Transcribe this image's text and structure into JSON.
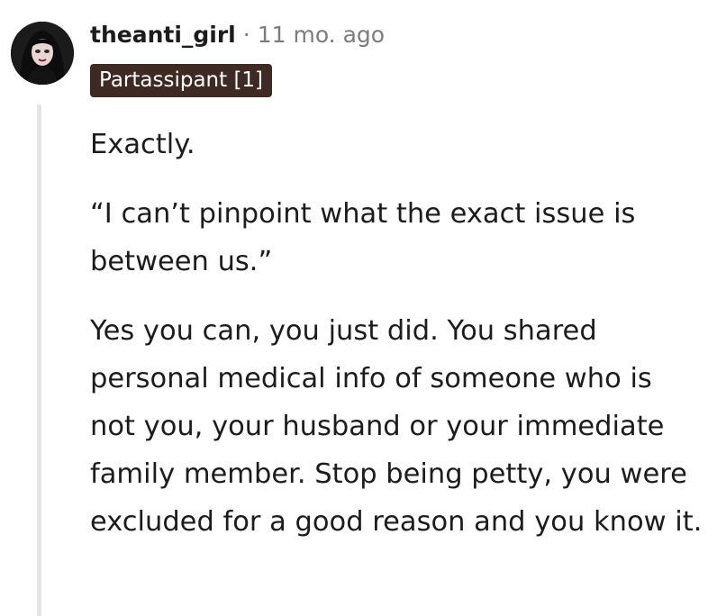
{
  "comment": {
    "author": "theanti_girl",
    "separator": "·",
    "timestamp": "11 mo. ago",
    "flair": "Partassipant [1]",
    "paragraphs": [
      "Exactly.",
      "“I can’t pinpoint what the exact issue is between us.”",
      "Yes you can, you just did. You shared personal medical info of someone who is not you, your husband or your immediate family member. Stop being petty, you were excluded for a good reason and you know it."
    ]
  },
  "colors": {
    "flair_background": "#3e2a22",
    "meta_text": "#7c7c7c",
    "thread_line": "#e5e5e5"
  },
  "icons": {
    "avatar": "user-avatar"
  }
}
